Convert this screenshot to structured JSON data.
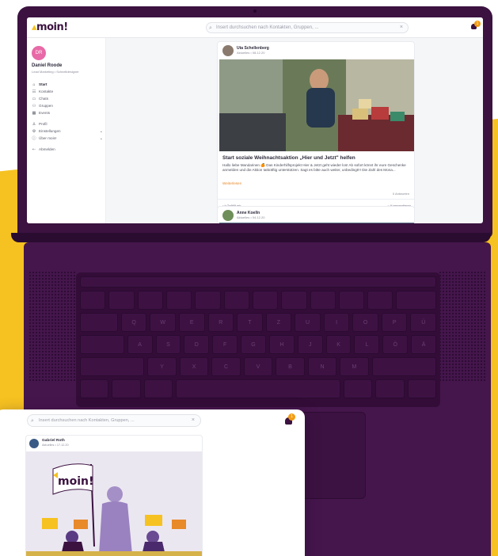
{
  "app": {
    "logo": "moin!",
    "search_placeholder": "Insert durchsuchen nach Kontakten, Gruppen, ...",
    "notification_count": "1",
    "accent": "#3b1240",
    "brand_yellow": "#f6c221"
  },
  "user": {
    "initials": "DR",
    "name": "Daniel Roode",
    "role": "Lead Marketing • Schnelldesigner"
  },
  "sidebar": {
    "items": [
      {
        "label": "Start",
        "icon": "home-icon"
      },
      {
        "label": "Kontakte",
        "icon": "contacts-icon"
      },
      {
        "label": "Chats",
        "icon": "chat-icon"
      },
      {
        "label": "Gruppen",
        "icon": "groups-icon"
      },
      {
        "label": "Events",
        "icon": "calendar-icon"
      }
    ],
    "secondary": [
      {
        "label": "Profil",
        "icon": "user-icon"
      },
      {
        "label": "Einstellungen",
        "icon": "gear-icon"
      },
      {
        "label": "Über moin!",
        "icon": "info-icon"
      }
    ],
    "logout": "Abmelden"
  },
  "post1": {
    "author": "Uta Schellenberg",
    "meta": "Aktuelles • 08.12.20",
    "title": "Start soziale Weihnachtsaktion „Hier und Jetzt\" helfen",
    "text": "Hallo liebe Mandarinen 🍊 Das Kinderhilfsprojekt Hier & Jetzt geht wieder los! Ab sofort könnt ihr eure Geschenke anmelden und die Aktion tatkräftig unterstützen. Sagt es bitte auch weiter, unbedingt!!! Die Zahl des Mona...",
    "readmore": "Weiterlesen",
    "answers": "0 Antworten",
    "like": "Gefällt mir",
    "comment": "Kommentieren"
  },
  "post2": {
    "author": "Anne Koelln",
    "meta": "Aktuelles • 04.12.20"
  },
  "overlay": {
    "search_placeholder": "Insert durchsuchen nach Kontakten, Gruppen, ...",
    "notification_count": "1",
    "post": {
      "author": "Gabriel Roth",
      "meta": "Aktuelles • 17.12.20",
      "banner_logo": "moin!"
    }
  },
  "keyboard": {
    "row1": [
      "Q",
      "W",
      "E",
      "R",
      "T",
      "Z",
      "U",
      "I",
      "O",
      "P",
      "Ü"
    ],
    "row2": [
      "A",
      "S",
      "D",
      "F",
      "G",
      "H",
      "J",
      "K",
      "L",
      "Ö",
      "Ä"
    ],
    "row3": [
      "Y",
      "X",
      "C",
      "V",
      "B",
      "N",
      "M"
    ]
  }
}
